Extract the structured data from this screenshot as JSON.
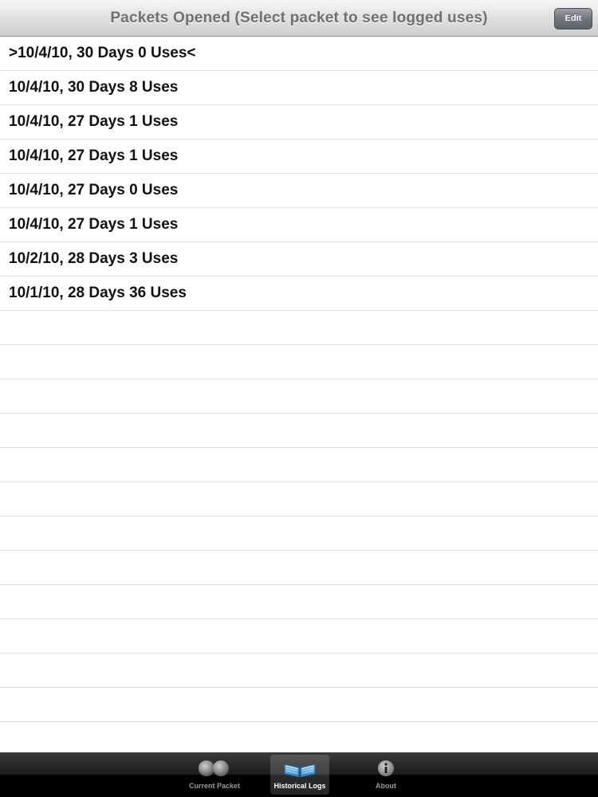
{
  "navbar": {
    "title": "Packets Opened (Select packet to see logged uses)",
    "edit_label": "Edit"
  },
  "packets": [
    ">10/4/10, 30 Days 0 Uses<",
    "10/4/10, 30 Days 8 Uses",
    "10/4/10, 27 Days 1 Uses",
    "10/4/10, 27 Days 1 Uses",
    "10/4/10, 27 Days 0 Uses",
    "10/4/10, 27 Days 1 Uses",
    "10/2/10, 28 Days 3 Uses",
    "10/1/10, 28 Days 36 Uses"
  ],
  "tabbar": {
    "tabs": [
      {
        "label": "Current Packet",
        "icon": "packet-icon",
        "selected": false
      },
      {
        "label": "Historical Logs",
        "icon": "book-icon",
        "selected": true
      },
      {
        "label": "About",
        "icon": "info-icon",
        "selected": false
      }
    ]
  },
  "colors": {
    "navbar_title": "#6f6f6f",
    "edit_button": "#6f767d",
    "tabbar": "#000000",
    "selected_icon": "#4fa3e0"
  }
}
